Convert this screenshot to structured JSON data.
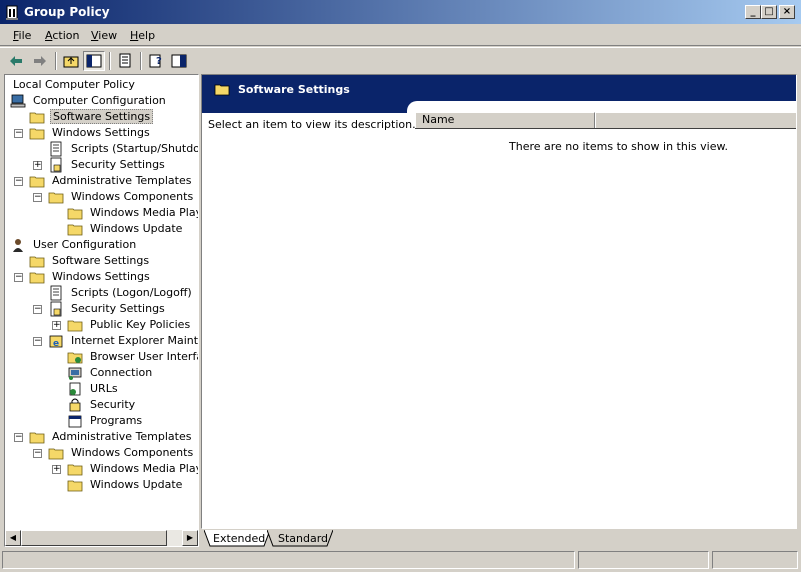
{
  "window": {
    "title": "Group Policy"
  },
  "menu": [
    {
      "label": "File",
      "u": "F",
      "rest": "ile"
    },
    {
      "label": "Action",
      "u": "A",
      "rest": "ction"
    },
    {
      "label": "View",
      "u": "V",
      "rest": "iew"
    },
    {
      "label": "Help",
      "u": "H",
      "rest": "elp"
    }
  ],
  "toolbar": {
    "buttons": [
      "back-arrow-icon",
      "forward-arrow-icon",
      "up-folder-icon",
      "show-hide-tree-icon",
      "export-list-icon",
      "help-icon",
      "show-hide-action-pane-icon"
    ]
  },
  "tree": [
    {
      "label": "Local Computer Policy",
      "icon": "policy-icon",
      "level": 0
    },
    {
      "label": "Computer Configuration",
      "icon": "computer-icon",
      "level": 1,
      "expander": ""
    },
    {
      "label": "Software Settings",
      "icon": "folder-icon",
      "level": 2,
      "selected": true
    },
    {
      "label": "Windows Settings",
      "icon": "folder-icon",
      "level": 2,
      "expander": "−"
    },
    {
      "label": "Scripts (Startup/Shutdown)",
      "icon": "scripts-icon",
      "level": 3
    },
    {
      "label": "Security Settings",
      "icon": "security-settings-icon",
      "level": 3,
      "expander": "+"
    },
    {
      "label": "Administrative Templates",
      "icon": "folder-icon",
      "level": 2,
      "expander": "−"
    },
    {
      "label": "Windows Components",
      "icon": "folder-icon",
      "level": 3,
      "expander": "−"
    },
    {
      "label": "Windows Media Player",
      "icon": "folder-icon",
      "level": 4
    },
    {
      "label": "Windows Update",
      "icon": "folder-icon",
      "level": 4
    },
    {
      "label": "User Configuration",
      "icon": "user-icon",
      "level": 1
    },
    {
      "label": "Software Settings",
      "icon": "folder-icon",
      "level": 2
    },
    {
      "label": "Windows Settings",
      "icon": "folder-icon",
      "level": 2,
      "expander": "−"
    },
    {
      "label": "Scripts (Logon/Logoff)",
      "icon": "scripts-icon",
      "level": 3
    },
    {
      "label": "Security Settings",
      "icon": "security-settings-icon",
      "level": 3,
      "expander": "−"
    },
    {
      "label": "Public Key Policies",
      "icon": "folder-icon",
      "level": 4,
      "expander": "+"
    },
    {
      "label": "Internet Explorer Maintenance",
      "icon": "ie-maintenance-icon",
      "level": 3,
      "expander": "−"
    },
    {
      "label": "Browser User Interface",
      "icon": "browser-ui-icon",
      "level": 4
    },
    {
      "label": "Connection",
      "icon": "connection-icon",
      "level": 4
    },
    {
      "label": "URLs",
      "icon": "urls-icon",
      "level": 4
    },
    {
      "label": "Security",
      "icon": "security-icon",
      "level": 4
    },
    {
      "label": "Programs",
      "icon": "programs-icon",
      "level": 4
    },
    {
      "label": "Administrative Templates",
      "icon": "folder-icon",
      "level": 2,
      "expander": "−"
    },
    {
      "label": "Windows Components",
      "icon": "folder-icon",
      "level": 3,
      "expander": "−"
    },
    {
      "label": "Windows Media Player",
      "icon": "folder-icon",
      "level": 4,
      "expander": "+"
    },
    {
      "label": "Windows Update",
      "icon": "folder-icon",
      "level": 4
    }
  ],
  "details": {
    "title": "Software Settings",
    "description": "Select an item to view its description.",
    "column_name": "Name",
    "empty_message": "There are no items to show in this view."
  },
  "tabs": [
    {
      "label": "Extended",
      "active": true
    },
    {
      "label": "Standard",
      "active": false
    }
  ],
  "colors": {
    "title_start": "#0a246a",
    "title_end": "#a6caf0",
    "folder": "#f5d868"
  }
}
